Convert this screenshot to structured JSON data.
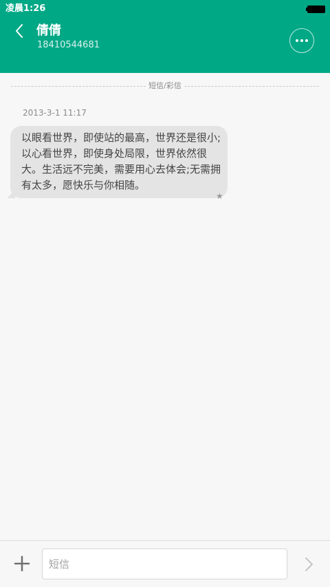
{
  "status_bar": {
    "time": "凌晨1:26"
  },
  "header": {
    "contact_name": "倩倩",
    "phone_number": "18410544681",
    "back_icon": "chevron-left-icon",
    "more_icon": "more-horizontal-icon"
  },
  "conversation": {
    "divider_label": "短信/彩信",
    "messages": [
      {
        "timestamp": "2013-3-1 11:17",
        "text": "以眼看世界，即使站的最高，世界还是很小;以心看世界，即使身处局限，世界依然很大。生活远不完美，需要用心去体会;无需拥有太多，愿快乐与你相随。",
        "starred": true
      }
    ]
  },
  "composer": {
    "placeholder": "短信",
    "value": "",
    "add_icon": "plus-icon",
    "send_icon": "chevron-right-icon"
  },
  "colors": {
    "header_bg": "#00a886",
    "page_bg": "#f7f7f7",
    "bubble_bg": "#e4e4e4"
  }
}
